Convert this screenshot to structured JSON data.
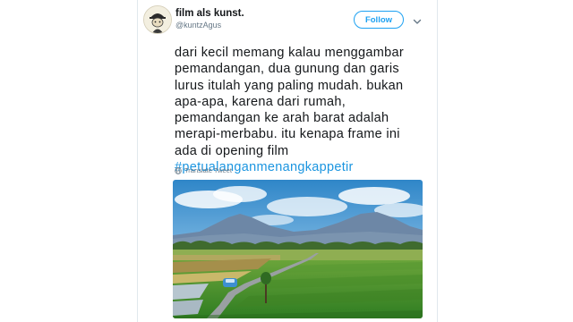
{
  "user": {
    "display_name": "film als kunst.",
    "handle": "@kuntzAgus"
  },
  "actions": {
    "follow_label": "Follow"
  },
  "tweet": {
    "lines": [
      "dari kecil memang kalau menggambar",
      "pemandangan, dua gunung dan garis",
      "lurus itulah yang paling mudah. bukan",
      "apa-apa, karena dari rumah,",
      "pemandangan ke arah barat adalah",
      "merapi-merbabu. itu kenapa frame ini",
      "ada di opening film"
    ],
    "hashtag": "#petualanganmenangkappetir",
    "translate_label": "Translate Tweet"
  },
  "icons": {
    "avatar": "avatar-portrait",
    "caret": "chevron-down-icon",
    "translate": "globe-icon"
  },
  "colors": {
    "accent": "#1da1f2",
    "hashtag": "#1b95e0",
    "text": "#14171a",
    "muted": "#657786",
    "border": "#e1e8ed"
  }
}
